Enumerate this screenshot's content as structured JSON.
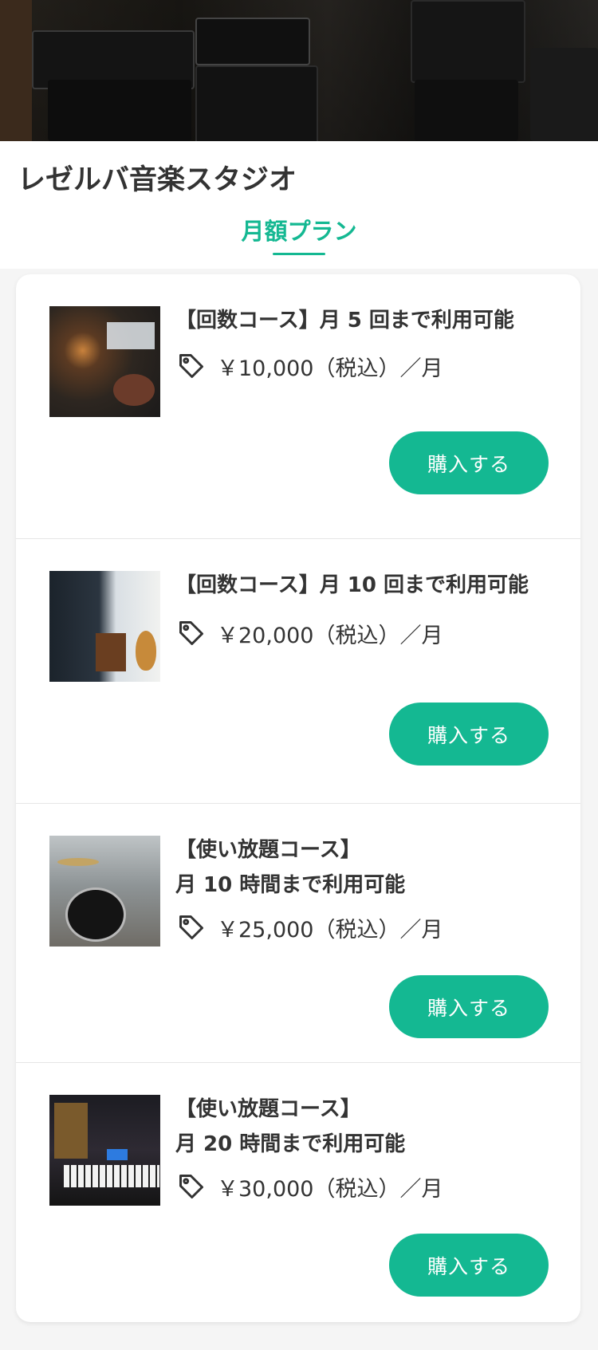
{
  "store": {
    "name": "レゼルバ音楽スタジオ"
  },
  "tabs": {
    "active": "月額プラン"
  },
  "icons": {
    "price": "tag-icon"
  },
  "colors": {
    "accent": "#14b892",
    "text": "#333333",
    "background": "#f5f5f5"
  },
  "plans": [
    {
      "title_lines": [
        "【回数コース】月 5 回まで利用可能"
      ],
      "price": "￥10,000（税込）／月",
      "button": "購入する"
    },
    {
      "title_lines": [
        "【回数コース】月 10 回まで利用可能"
      ],
      "price": "￥20,000（税込）／月",
      "button": "購入する"
    },
    {
      "title_lines": [
        "【使い放題コース】",
        "月 10 時間まで利用可能"
      ],
      "price": "￥25,000（税込）／月",
      "button": "購入する"
    },
    {
      "title_lines": [
        "【使い放題コース】",
        "月 20 時間まで利用可能"
      ],
      "price": "￥30,000（税込）／月",
      "button": "購入する"
    }
  ]
}
